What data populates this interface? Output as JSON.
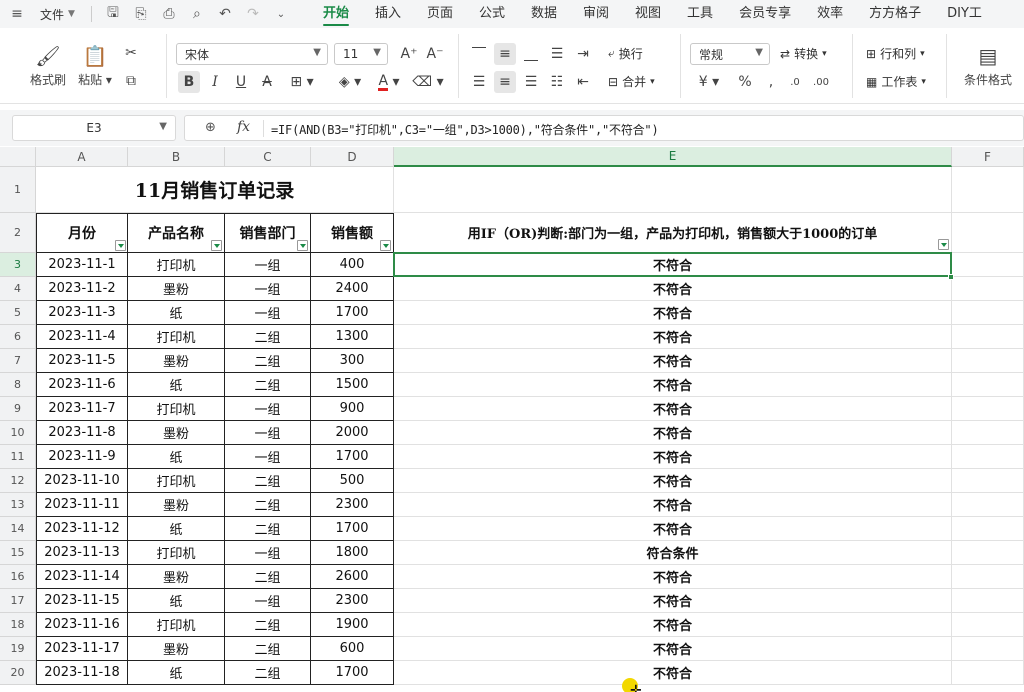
{
  "menubar": {
    "file_label": "文件",
    "tabs": [
      "开始",
      "插入",
      "页面",
      "公式",
      "数据",
      "审阅",
      "视图",
      "工具",
      "会员专享",
      "效率",
      "方方格子",
      "DIY工"
    ]
  },
  "ribbon": {
    "format_painter": "格式刷",
    "paste": "粘贴",
    "font_name": "宋体",
    "font_size": "11",
    "wrap": "换行",
    "merge": "合并",
    "number_format": "常规",
    "convert": "转换",
    "row_col": "行和列",
    "worksheet": "工作表",
    "cond_format": "条件格式"
  },
  "formula": {
    "name_box": "E3",
    "fx": "fx",
    "text": "=IF(AND(B3=\"打印机\",C3=\"一组\",D3>1000),\"符合条件\",\"不符合\")"
  },
  "columns": [
    "A",
    "B",
    "C",
    "D",
    "E",
    "F"
  ],
  "sheet": {
    "title": "11月销售订单记录",
    "headers": [
      "月份",
      "产品名称",
      "销售部门",
      "销售额",
      "用IF（OR)判断:部门为一组，产品为打印机，销售额大于1000的订单"
    ],
    "rows": [
      [
        "3",
        "2023-11-1",
        "打印机",
        "一组",
        "400",
        "不符合"
      ],
      [
        "4",
        "2023-11-2",
        "墨粉",
        "一组",
        "2400",
        "不符合"
      ],
      [
        "5",
        "2023-11-3",
        "纸",
        "一组",
        "1700",
        "不符合"
      ],
      [
        "6",
        "2023-11-4",
        "打印机",
        "二组",
        "1300",
        "不符合"
      ],
      [
        "7",
        "2023-11-5",
        "墨粉",
        "二组",
        "300",
        "不符合"
      ],
      [
        "8",
        "2023-11-6",
        "纸",
        "二组",
        "1500",
        "不符合"
      ],
      [
        "9",
        "2023-11-7",
        "打印机",
        "一组",
        "900",
        "不符合"
      ],
      [
        "10",
        "2023-11-8",
        "墨粉",
        "一组",
        "2000",
        "不符合"
      ],
      [
        "11",
        "2023-11-9",
        "纸",
        "一组",
        "1700",
        "不符合"
      ],
      [
        "12",
        "2023-11-10",
        "打印机",
        "二组",
        "500",
        "不符合"
      ],
      [
        "13",
        "2023-11-11",
        "墨粉",
        "二组",
        "2300",
        "不符合"
      ],
      [
        "14",
        "2023-11-12",
        "纸",
        "二组",
        "1700",
        "不符合"
      ],
      [
        "15",
        "2023-11-13",
        "打印机",
        "一组",
        "1800",
        "符合条件"
      ],
      [
        "16",
        "2023-11-14",
        "墨粉",
        "二组",
        "2600",
        "不符合"
      ],
      [
        "17",
        "2023-11-15",
        "纸",
        "一组",
        "2300",
        "不符合"
      ],
      [
        "18",
        "2023-11-16",
        "打印机",
        "二组",
        "1900",
        "不符合"
      ],
      [
        "19",
        "2023-11-17",
        "墨粉",
        "二组",
        "600",
        "不符合"
      ],
      [
        "20",
        "2023-11-18",
        "纸",
        "二组",
        "1700",
        "不符合"
      ]
    ]
  },
  "colors": {
    "accent": "#1a8a47"
  }
}
